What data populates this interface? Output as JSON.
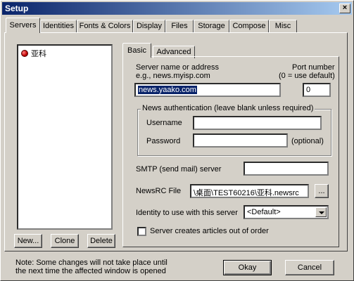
{
  "window": {
    "title": "Setup"
  },
  "tabs": [
    "Servers",
    "Identities",
    "Fonts & Colors",
    "Display",
    "Files",
    "Storage",
    "Compose",
    "Misc"
  ],
  "server_list": {
    "items": [
      {
        "name": "亚科"
      }
    ]
  },
  "server_buttons": {
    "new": "New...",
    "clone": "Clone",
    "delete": "Delete"
  },
  "subtabs": [
    "Basic",
    "Advanced"
  ],
  "basic": {
    "server_label": "Server name or address",
    "server_example": "e.g., news.myisp.com",
    "server_value": "news.yaako.com",
    "port_label": "Port number",
    "port_hint": "(0 = use default)",
    "port_value": "0",
    "auth_group_label": "News authentication (leave blank unless required)",
    "username_label": "Username",
    "username_value": "",
    "password_label": "Password",
    "password_value": "",
    "password_hint": "(optional)",
    "smtp_label": "SMTP (send mail) server",
    "smtp_value": "",
    "newsrc_label": "NewsRC File",
    "newsrc_value": "\\桌面\\TEST60216\\亚科.newsrc",
    "browse_label": "...",
    "identity_label": "Identity to use with this server",
    "identity_value": "<Default>",
    "creates_out_of_order_label": "Server creates articles out of order",
    "creates_out_of_order_checked": false
  },
  "footer": {
    "note_line1": "Note: Some changes will not take place until",
    "note_line2": "the next time the affected window is opened",
    "okay": "Okay",
    "cancel": "Cancel"
  }
}
